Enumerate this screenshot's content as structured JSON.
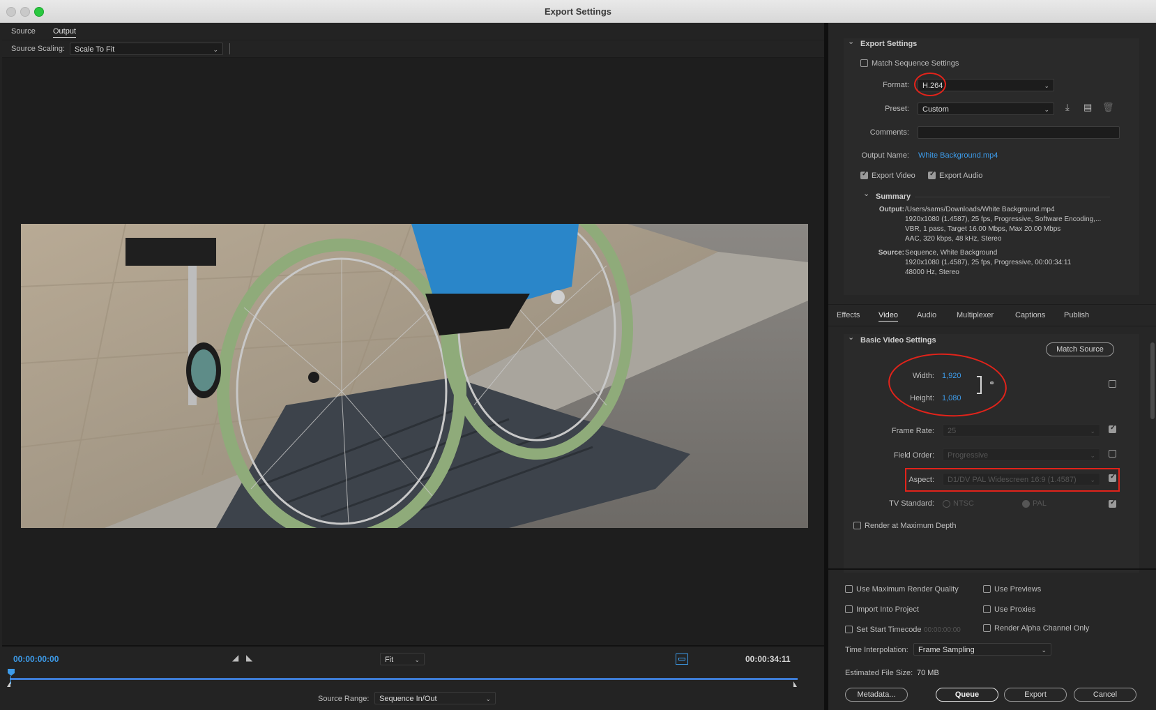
{
  "window": {
    "title": "Export Settings"
  },
  "left": {
    "tabs": [
      "Source",
      "Output"
    ],
    "active_tab": "Output",
    "source_scaling": {
      "label": "Source Scaling:",
      "value": "Scale To Fit"
    },
    "timeline": {
      "current_time": "00:00:00:00",
      "duration": "00:00:34:11",
      "zoom": "Fit",
      "source_range_label": "Source Range:",
      "source_range_value": "Sequence In/Out"
    }
  },
  "export_settings": {
    "heading": "Export Settings",
    "match_sequence": "Match Sequence Settings",
    "format_label": "Format:",
    "format_value": "H.264",
    "preset_label": "Preset:",
    "preset_value": "Custom",
    "comments_label": "Comments:",
    "comments_value": "",
    "output_name_label": "Output Name:",
    "output_name_value": "White Background.mp4",
    "export_video": "Export Video",
    "export_audio": "Export Audio",
    "summary_heading": "Summary",
    "output_key": "Output:",
    "output_lines": [
      "/Users/sams/Downloads/White Background.mp4",
      "1920x1080 (1.4587), 25 fps, Progressive, Software Encoding,...",
      "VBR, 1 pass, Target 16.00 Mbps, Max 20.00 Mbps",
      "AAC, 320 kbps, 48 kHz, Stereo"
    ],
    "source_key": "Source:",
    "source_lines": [
      "Sequence, White Background",
      "1920x1080 (1.4587), 25 fps, Progressive, 00:00:34:11",
      "48000 Hz, Stereo"
    ]
  },
  "settings_tabs": [
    "Effects",
    "Video",
    "Audio",
    "Multiplexer",
    "Captions",
    "Publish"
  ],
  "active_settings_tab": "Video",
  "video": {
    "heading": "Basic Video Settings",
    "match_source": "Match Source",
    "width_label": "Width:",
    "width_value": "1,920",
    "height_label": "Height:",
    "height_value": "1,080",
    "frame_rate_label": "Frame Rate:",
    "frame_rate_value": "25",
    "field_order_label": "Field Order:",
    "field_order_value": "Progressive",
    "aspect_label": "Aspect:",
    "aspect_value": "D1/DV PAL Widescreen 16:9 (1.4587)",
    "tv_standard_label": "TV Standard:",
    "ntsc": "NTSC",
    "pal": "PAL",
    "render_max_depth": "Render at Maximum Depth"
  },
  "bottom": {
    "use_max_quality": "Use Maximum Render Quality",
    "use_previews": "Use Previews",
    "import_into_project": "Import Into Project",
    "use_proxies": "Use Proxies",
    "set_start_timecode": "Set Start Timecode",
    "start_timecode_value": "00:00:00:00",
    "render_alpha": "Render Alpha Channel Only",
    "time_interp_label": "Time Interpolation:",
    "time_interp_value": "Frame Sampling",
    "file_size_label": "Estimated File Size:",
    "file_size_value": "70 MB",
    "metadata_btn": "Metadata...",
    "queue_btn": "Queue",
    "export_btn": "Export",
    "cancel_btn": "Cancel"
  },
  "colors": {
    "accent": "#3d9be9",
    "annotation": "#e2231a",
    "panel": "#262626"
  }
}
